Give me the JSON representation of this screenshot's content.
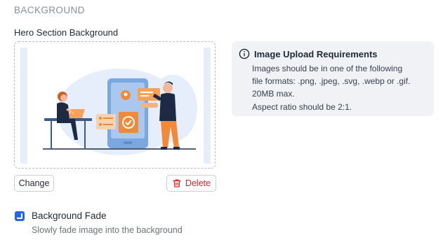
{
  "section": {
    "title": "BACKGROUND"
  },
  "hero": {
    "label": "Hero Section Background",
    "image_icon": "person-at-desk-with-phone-illustration",
    "change_label": "Change",
    "delete_label": "Delete",
    "delete_icon": "trash-icon",
    "delete_color": "#dc2626"
  },
  "requirements": {
    "icon": "info-icon",
    "title": "Image Upload Requirements",
    "lines": [
      "Images should be in one of the following",
      "file formats: .png, .jpeg, .svg, .webp or .gif.",
      "20MB max.",
      "Aspect ratio should be 2:1."
    ]
  },
  "fade": {
    "checked": true,
    "label": "Background Fade",
    "description": "Slowly fade image into the background",
    "accent": "#2563eb"
  }
}
